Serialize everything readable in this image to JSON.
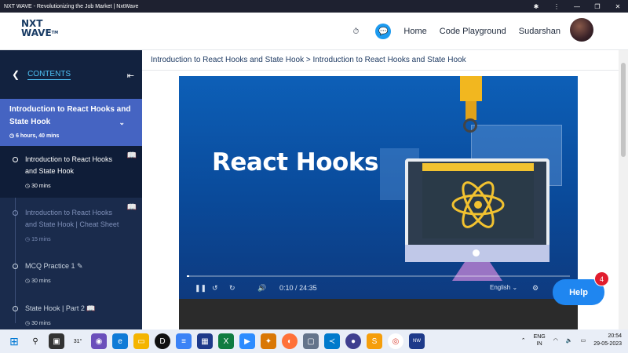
{
  "window": {
    "title": "NXT WAVE - Revolutionizing the Job Market | NxtWave",
    "controls": [
      "✱",
      "⋮",
      "—",
      "❐",
      "✕"
    ]
  },
  "header": {
    "logo_line1": "NXT",
    "logo_line2": "WAVE",
    "logo_tm": "TM",
    "nav": {
      "home": "Home",
      "playground": "Code Playground",
      "user": "Sudarshan"
    }
  },
  "sidebar": {
    "contents_label": "CONTENTS",
    "module": {
      "title": "Introduction to React Hooks and State Hook",
      "duration": "6 hours, 40 mins"
    },
    "items": [
      {
        "title": "Introduction to React Hooks and State Hook",
        "time": "30 mins"
      },
      {
        "title": "Introduction to React Hooks and State Hook | Cheat Sheet",
        "time": "15 mins"
      },
      {
        "title": "MCQ Practice 1",
        "time": "30 mins"
      },
      {
        "title": "State Hook | Part 2",
        "time": "30 mins"
      }
    ]
  },
  "breadcrumb": "Introduction to React Hooks and State Hook > Introduction to React Hooks and State Hook",
  "video": {
    "title_text": "React Hooks",
    "current_time": "0:10",
    "separator": "/",
    "duration": "24:35",
    "language": "English",
    "progress_fraction": 0.007
  },
  "help": {
    "label": "Help",
    "badge_count": "4"
  },
  "taskbar": {
    "weather": "31°",
    "lang_line1": "ENG",
    "lang_line2": "IN",
    "time": "20:54",
    "date": "29-05-2023"
  },
  "colors": {
    "sidebar_bg": "#1a2b4c",
    "module_bg": "#4564c2",
    "accent": "#4fc3f7",
    "help": "#1f86f0",
    "badge": "#e11d2e"
  }
}
